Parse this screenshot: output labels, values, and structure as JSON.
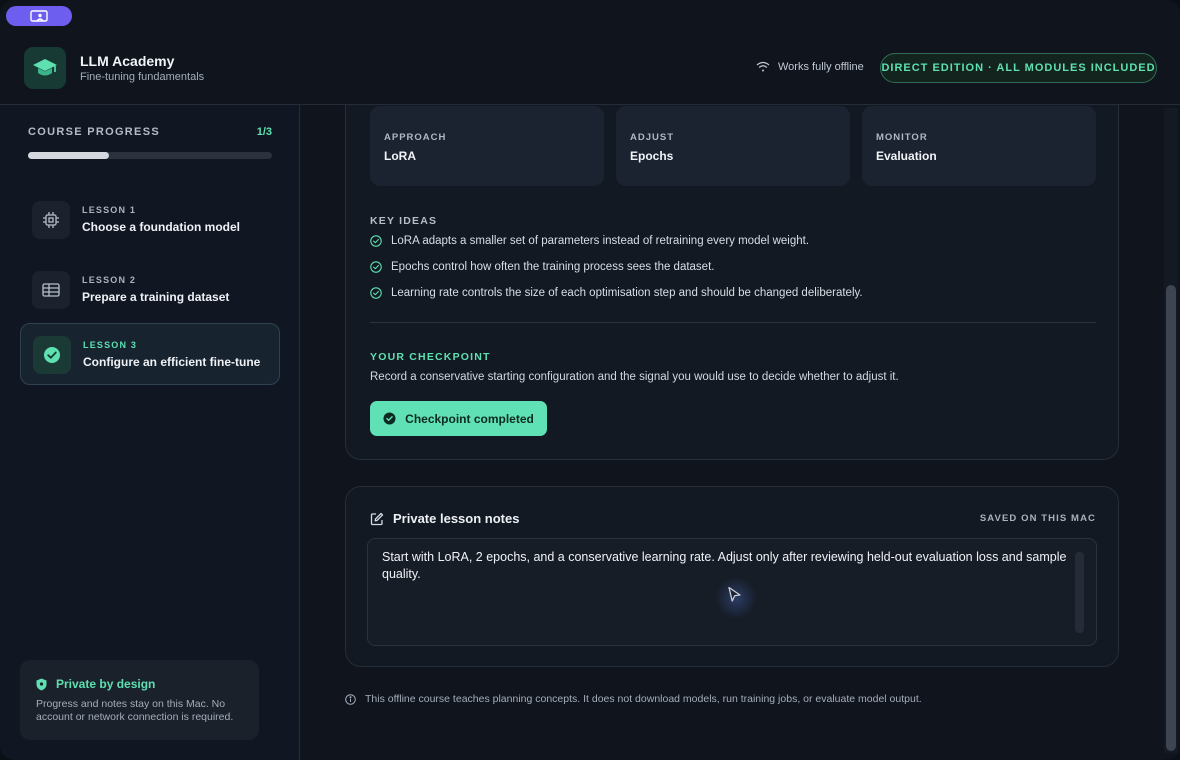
{
  "header": {
    "app_title": "LLM Academy",
    "app_subtitle": "Fine-tuning fundamentals",
    "offline_label": "Works fully offline",
    "edition_badge": "DIRECT EDITION · ALL MODULES INCLUDED"
  },
  "sidebar": {
    "progress_title": "COURSE PROGRESS",
    "progress_count": "1/3",
    "progress_fraction": 0.33,
    "lessons": [
      {
        "kicker": "LESSON 1",
        "title": "Choose a foundation model",
        "icon": "chip-icon",
        "active": false
      },
      {
        "kicker": "LESSON 2",
        "title": "Prepare a training dataset",
        "icon": "table-icon",
        "active": false
      },
      {
        "kicker": "LESSON 3",
        "title": "Configure an efficient fine-tune",
        "icon": "check-circle-icon",
        "active": true
      }
    ],
    "privacy": {
      "title": "Private by design",
      "text": "Progress and notes stay on this Mac. No account or network connection is required."
    }
  },
  "lesson_card": {
    "stats": [
      {
        "label": "APPROACH",
        "value": "LoRA"
      },
      {
        "label": "ADJUST",
        "value": "Epochs"
      },
      {
        "label": "MONITOR",
        "value": "Evaluation"
      }
    ],
    "key_ideas_title": "KEY IDEAS",
    "key_ideas": [
      "LoRA adapts a smaller set of parameters instead of retraining every model weight.",
      "Epochs control how often the training process sees the dataset.",
      "Learning rate controls the size of each optimisation step and should be changed deliberately."
    ],
    "checkpoint_title": "YOUR CHECKPOINT",
    "checkpoint_description": "Record a conservative starting configuration and the signal you would use to decide whether to adjust it.",
    "checkpoint_button": "Checkpoint completed"
  },
  "notes": {
    "title": "Private lesson notes",
    "saved_label": "SAVED ON THIS MAC",
    "text": "Start with LoRA, 2 epochs, and a conservative learning rate. Adjust only after reviewing held-out evaluation loss and sample quality."
  },
  "footer_note": "This offline course teaches planning concepts. It does not download models, run training jobs, or evaluate model output.",
  "colors": {
    "accent": "#5ee0b0",
    "view_pill": "#6d5ef0",
    "background": "#0f141d"
  }
}
